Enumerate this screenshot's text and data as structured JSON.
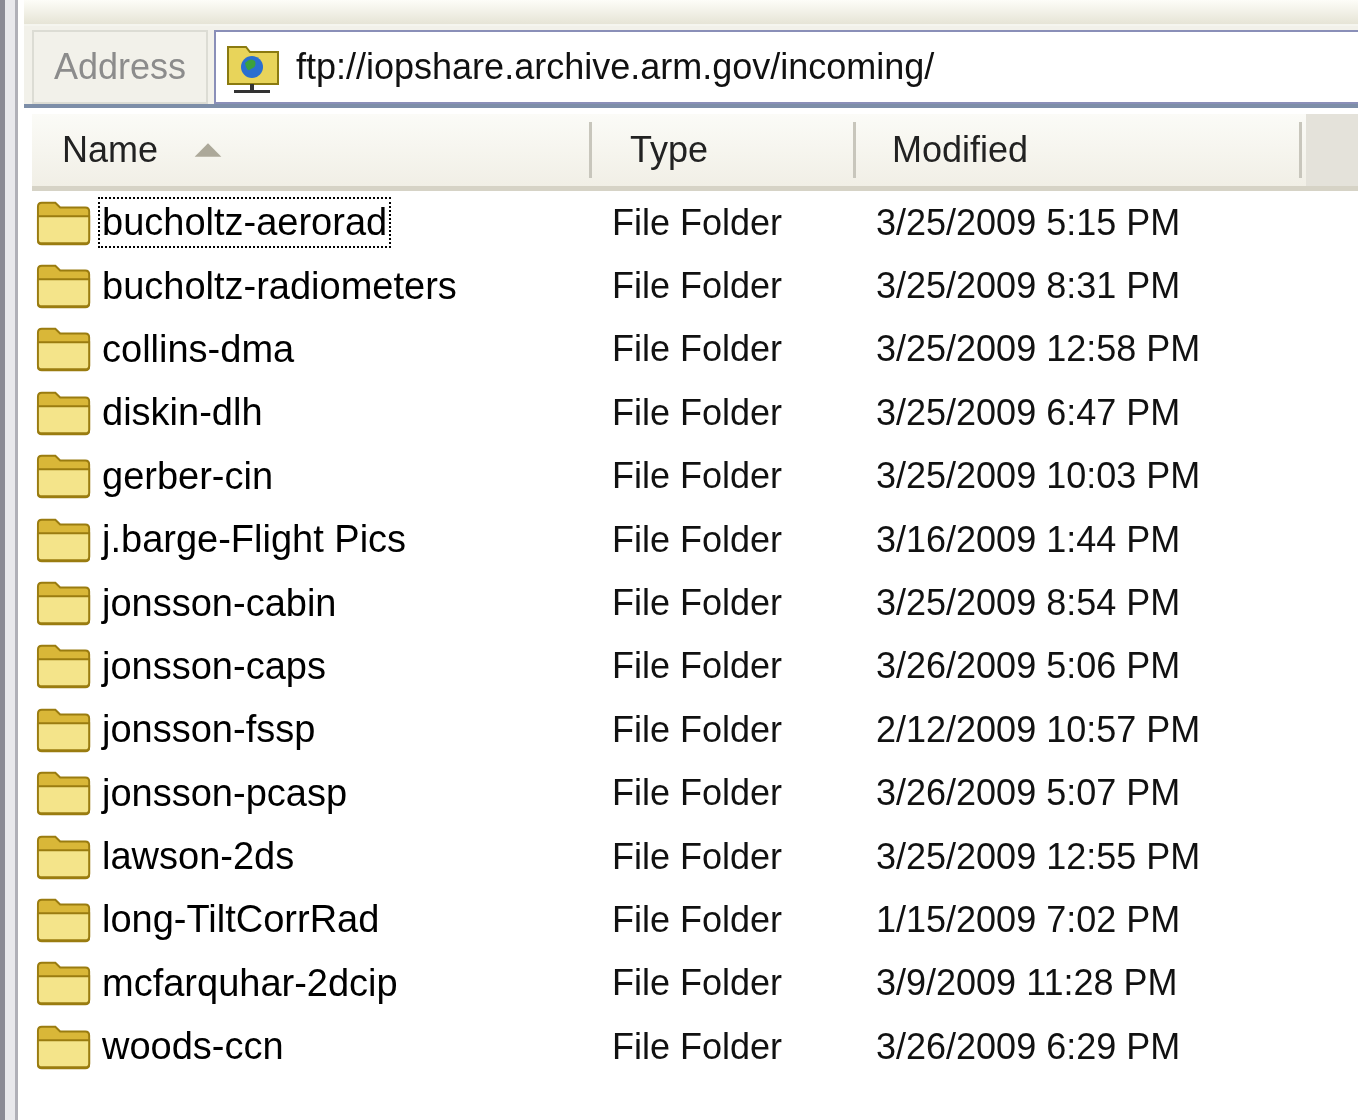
{
  "address_bar": {
    "label": "Address",
    "value": "ftp://iopshare.archive.arm.gov/incoming/"
  },
  "table": {
    "columns": [
      {
        "label": "Name",
        "sorted": true
      },
      {
        "label": "Type",
        "sorted": false
      },
      {
        "label": "Modified",
        "sorted": false
      }
    ],
    "rows": [
      {
        "name": "bucholtz-aerorad",
        "type": "File Folder",
        "modified": "3/25/2009 5:15 PM",
        "focused": true
      },
      {
        "name": "bucholtz-radiometers",
        "type": "File Folder",
        "modified": "3/25/2009 8:31 PM",
        "focused": false
      },
      {
        "name": "collins-dma",
        "type": "File Folder",
        "modified": "3/25/2009 12:58 PM",
        "focused": false
      },
      {
        "name": "diskin-dlh",
        "type": "File Folder",
        "modified": "3/25/2009 6:47 PM",
        "focused": false
      },
      {
        "name": "gerber-cin",
        "type": "File Folder",
        "modified": "3/25/2009 10:03 PM",
        "focused": false
      },
      {
        "name": "j.barge-Flight Pics",
        "type": "File Folder",
        "modified": "3/16/2009 1:44 PM",
        "focused": false
      },
      {
        "name": "jonsson-cabin",
        "type": "File Folder",
        "modified": "3/25/2009 8:54 PM",
        "focused": false
      },
      {
        "name": "jonsson-caps",
        "type": "File Folder",
        "modified": "3/26/2009 5:06 PM",
        "focused": false
      },
      {
        "name": "jonsson-fssp",
        "type": "File Folder",
        "modified": "2/12/2009 10:57 PM",
        "focused": false
      },
      {
        "name": "jonsson-pcasp",
        "type": "File Folder",
        "modified": "3/26/2009 5:07 PM",
        "focused": false
      },
      {
        "name": "lawson-2ds",
        "type": "File Folder",
        "modified": "3/25/2009 12:55 PM",
        "focused": false
      },
      {
        "name": "long-TiltCorrRad",
        "type": "File Folder",
        "modified": "1/15/2009 7:02 PM",
        "focused": false
      },
      {
        "name": "mcfarquhar-2dcip",
        "type": "File Folder",
        "modified": "3/9/2009 11:28 PM",
        "focused": false
      },
      {
        "name": "woods-ccn",
        "type": "File Folder",
        "modified": "3/26/2009 6:29 PM",
        "focused": false
      }
    ]
  }
}
